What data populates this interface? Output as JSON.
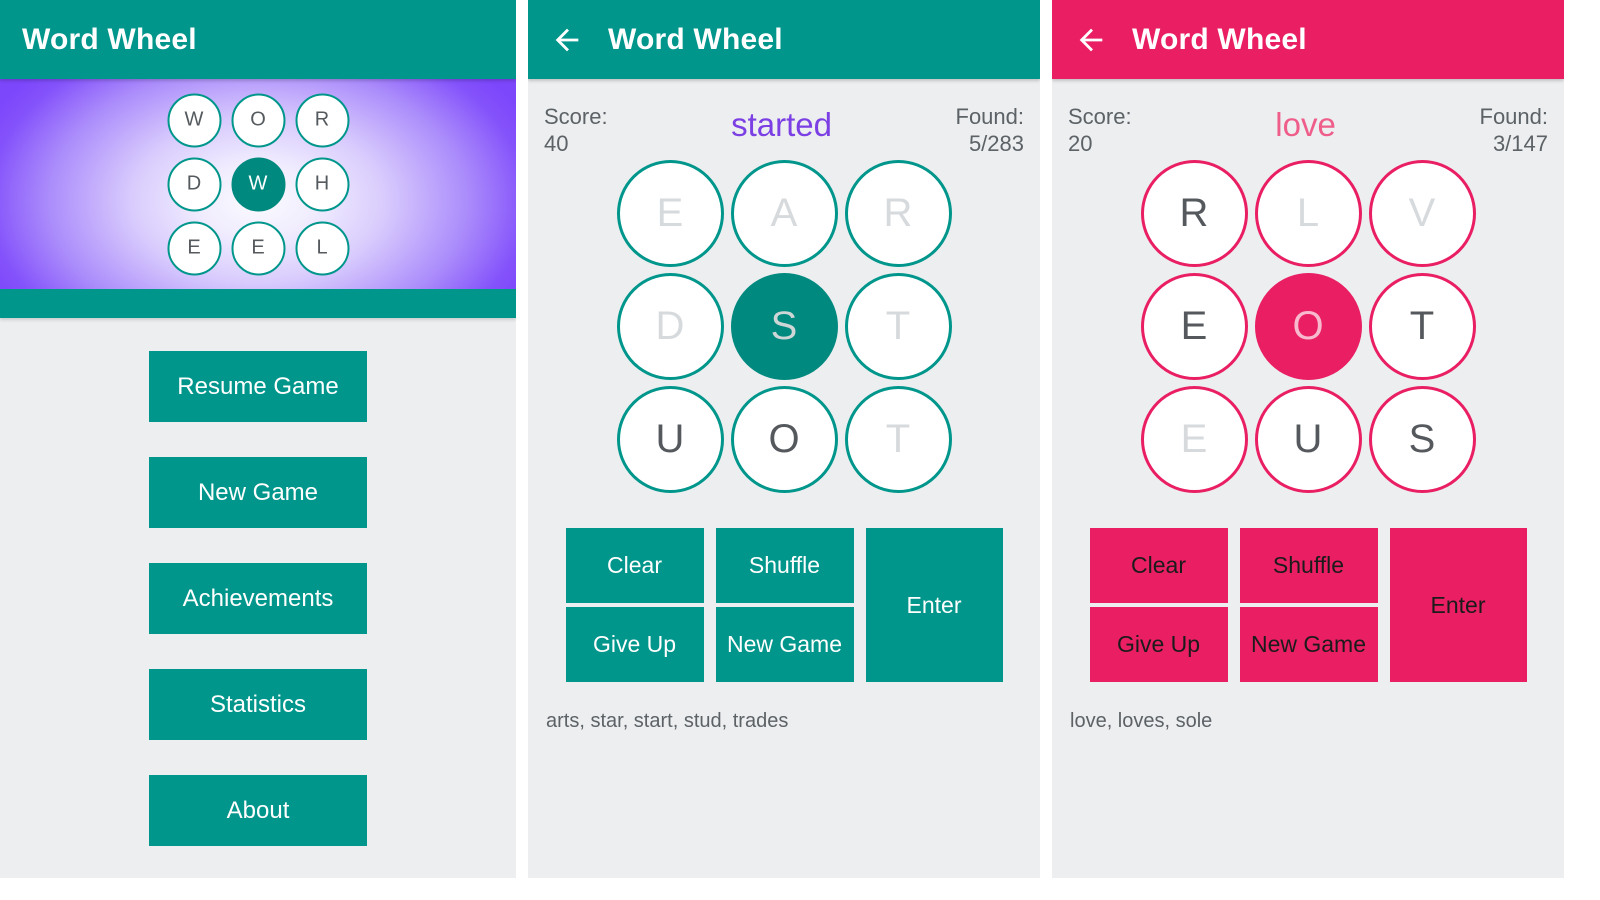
{
  "colors": {
    "teal": "#00968b",
    "teal_dark": "#00897f",
    "pink": "#e91e63",
    "purple_word": "#7b3fe4",
    "pink_word": "#ef5d8a",
    "bg": "#eceef0"
  },
  "menu_screen": {
    "appbar_title": "Word Wheel",
    "hero_letters": [
      {
        "letter": "W",
        "state": "normal"
      },
      {
        "letter": "O",
        "state": "normal"
      },
      {
        "letter": "R",
        "state": "normal"
      },
      {
        "letter": "D",
        "state": "normal"
      },
      {
        "letter": "W",
        "state": "selected"
      },
      {
        "letter": "H",
        "state": "normal"
      },
      {
        "letter": "E",
        "state": "normal"
      },
      {
        "letter": "E",
        "state": "normal"
      },
      {
        "letter": "L",
        "state": "normal"
      }
    ],
    "buttons": [
      {
        "label": "Resume Game"
      },
      {
        "label": "New Game"
      },
      {
        "label": "Achievements"
      },
      {
        "label": "Statistics"
      },
      {
        "label": "About"
      }
    ]
  },
  "game_teal": {
    "appbar_title": "Word Wheel",
    "back_icon": "arrow-left-icon",
    "score_label": "Score:",
    "score_value": "40",
    "found_label": "Found:",
    "found_value": "5/283",
    "current_word": "started",
    "letters": [
      {
        "letter": "E",
        "state": "used"
      },
      {
        "letter": "A",
        "state": "used"
      },
      {
        "letter": "R",
        "state": "used"
      },
      {
        "letter": "D",
        "state": "used"
      },
      {
        "letter": "S",
        "state": "selected"
      },
      {
        "letter": "T",
        "state": "used"
      },
      {
        "letter": "U",
        "state": "normal"
      },
      {
        "letter": "O",
        "state": "normal"
      },
      {
        "letter": "T",
        "state": "used"
      }
    ],
    "actions": {
      "clear": "Clear",
      "shuffle": "Shuffle",
      "give_up": "Give Up",
      "new_game": "New Game",
      "enter": "Enter"
    },
    "found_words": "arts, star, start, stud, trades"
  },
  "game_pink": {
    "appbar_title": "Word Wheel",
    "back_icon": "arrow-left-icon",
    "score_label": "Score:",
    "score_value": "20",
    "found_label": "Found:",
    "found_value": "3/147",
    "current_word": "love",
    "letters": [
      {
        "letter": "R",
        "state": "normal"
      },
      {
        "letter": "L",
        "state": "used"
      },
      {
        "letter": "V",
        "state": "used"
      },
      {
        "letter": "E",
        "state": "normal"
      },
      {
        "letter": "O",
        "state": "selected"
      },
      {
        "letter": "T",
        "state": "normal"
      },
      {
        "letter": "E",
        "state": "used"
      },
      {
        "letter": "U",
        "state": "normal"
      },
      {
        "letter": "S",
        "state": "normal"
      }
    ],
    "actions": {
      "clear": "Clear",
      "shuffle": "Shuffle",
      "give_up": "Give Up",
      "new_game": "New Game",
      "enter": "Enter"
    },
    "found_words": "love, loves, sole"
  }
}
